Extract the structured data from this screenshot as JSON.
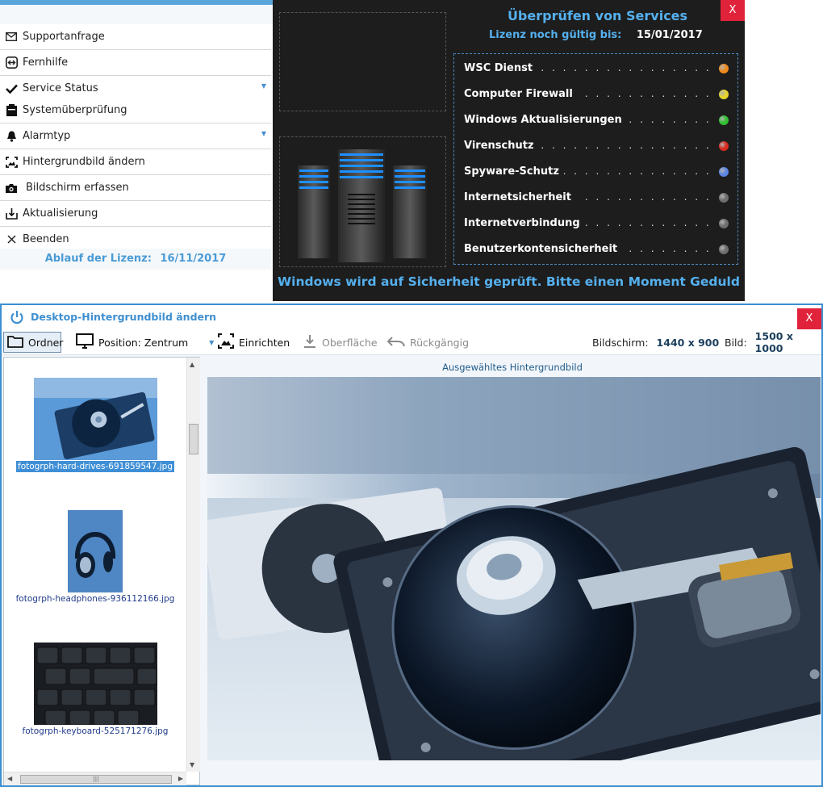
{
  "tray_menu": {
    "items": [
      {
        "label": "Supportanfrage",
        "icon": "mail-icon"
      },
      {
        "label": "Fernhilfe",
        "icon": "remote-help-icon"
      },
      {
        "label": "Service Status",
        "icon": "checkmark-icon"
      },
      {
        "label": "Systemüberprüfung",
        "icon": "clipboard-icon"
      },
      {
        "label": "Alarmtyp",
        "icon": "bell-icon"
      },
      {
        "label": "Hintergrundbild ändern",
        "icon": "wallpaper-frame-icon"
      },
      {
        "label": "Bildschirm erfassen",
        "icon": "camera-icon"
      },
      {
        "label": "Aktualisierung",
        "icon": "download-icon"
      },
      {
        "label": "Beenden",
        "icon": "close-icon"
      }
    ],
    "license_label": "Ablauf der Lizenz:",
    "license_date": "16/11/2017"
  },
  "service_check": {
    "title": "Überprüfen von Services",
    "close_label": "X",
    "license_label": "Lizenz noch gültig bis:",
    "license_date": "15/01/2017",
    "services": [
      {
        "name": "WSC Dienst",
        "color": "#f08a1c"
      },
      {
        "name": "Computer Firewall",
        "color": "#e6d42a"
      },
      {
        "name": "Windows Aktualisierungen",
        "color": "#2fc12f"
      },
      {
        "name": "Virenschutz",
        "color": "#d62a1e"
      },
      {
        "name": "Spyware-Schutz",
        "color": "#5b86e6"
      },
      {
        "name": "Internetsicherheit",
        "color": "#6e6e6e"
      },
      {
        "name": "Internetverbindung",
        "color": "#6e6e6e"
      },
      {
        "name": "Benutzerkontensicherheit",
        "color": "#6e6e6e"
      }
    ],
    "status_message": "Windows wird auf Sicherheit geprüft. Bitte einen Moment Geduld"
  },
  "wallpaper_window": {
    "title": "Desktop-Hintergrundbild ändern",
    "close_label": "X",
    "toolbar": {
      "folder_label": "Ordner",
      "position_label": "Position: Zentrum",
      "fit_label": "Einrichten",
      "surface_label": "Oberfläche",
      "undo_label": "Rückgängig",
      "screen_label": "Bildschirm:",
      "screen_value": "1440 x 900",
      "image_label": "Bild:",
      "image_value": "1500 x 1000"
    },
    "thumbnails": [
      {
        "file": "fotogrph-hard-drives-691859547.jpg",
        "selected": true
      },
      {
        "file": "fotogrph-headphones-936112166.jpg",
        "selected": false
      },
      {
        "file": "fotogrph-keyboard-525171276.jpg",
        "selected": false
      }
    ],
    "preview_caption": "Ausgewähltes Hintergrundbild"
  }
}
